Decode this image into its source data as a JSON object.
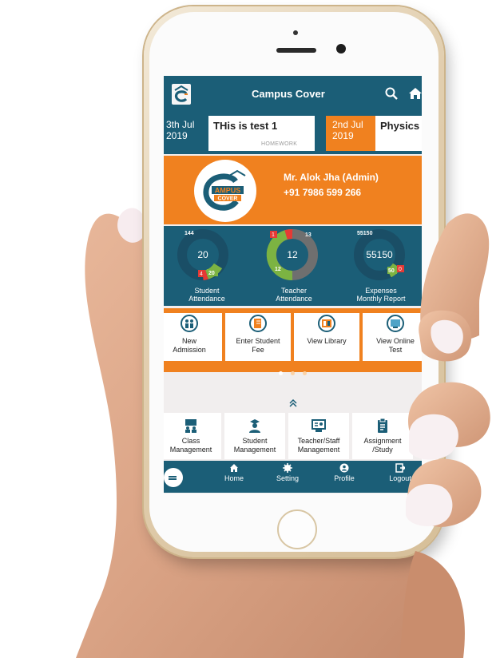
{
  "app": {
    "title": "Campus Cover",
    "logo_text": "CAMPUS COVER"
  },
  "notices": [
    {
      "date_line1": "3th Jul",
      "date_line2": "2019",
      "title": "THis is test 1",
      "tag": "HOMEWORK"
    },
    {
      "date_line1": "2nd Jul",
      "date_line2": "2019",
      "title": "Physics",
      "tag": ""
    }
  ],
  "profile": {
    "name": "Mr. Alok Jha (Admin)",
    "phone": "+91 7986 599 266",
    "logo_top": "AMPUS",
    "logo_bottom": "COVER"
  },
  "stats": [
    {
      "label_line1": "Student",
      "label_line2": "Attendance",
      "center": "20",
      "top_badge": "144",
      "red_badge": "4",
      "green_badge": "20"
    },
    {
      "label_line1": "Teacher",
      "label_line2": "Attendance",
      "center": "12",
      "top_badge": "13",
      "red_badge": "1",
      "green_badge": "12"
    },
    {
      "label_line1": "Expenses",
      "label_line2": "Monthly Report",
      "center": "55150",
      "top_badge": "55150",
      "red_badge": "0",
      "green_badge": "50"
    }
  ],
  "quick_actions": [
    {
      "line1": "New",
      "line2": "Admission",
      "icon": "admission-icon"
    },
    {
      "line1": "Enter Student",
      "line2": "Fee",
      "icon": "fee-icon"
    },
    {
      "line1": "View Library",
      "line2": "",
      "icon": "library-icon"
    },
    {
      "line1": "View Online",
      "line2": "Test",
      "icon": "online-test-icon"
    }
  ],
  "modules": [
    {
      "line1": "Class",
      "line2": "Management",
      "icon": "class-icon"
    },
    {
      "line1": "Student",
      "line2": "Management",
      "icon": "student-icon"
    },
    {
      "line1": "Teacher/Staff",
      "line2": "Management",
      "icon": "teacher-icon"
    },
    {
      "line1": "Assignment",
      "line2": "/Study",
      "icon": "assignment-icon"
    }
  ],
  "nav": {
    "home": "Home",
    "setting": "Setting",
    "profile": "Profile",
    "logout": "Logout"
  },
  "colors": {
    "primary": "#1b5e77",
    "accent": "#f0811f",
    "green": "#7cb342",
    "red": "#e53935"
  }
}
